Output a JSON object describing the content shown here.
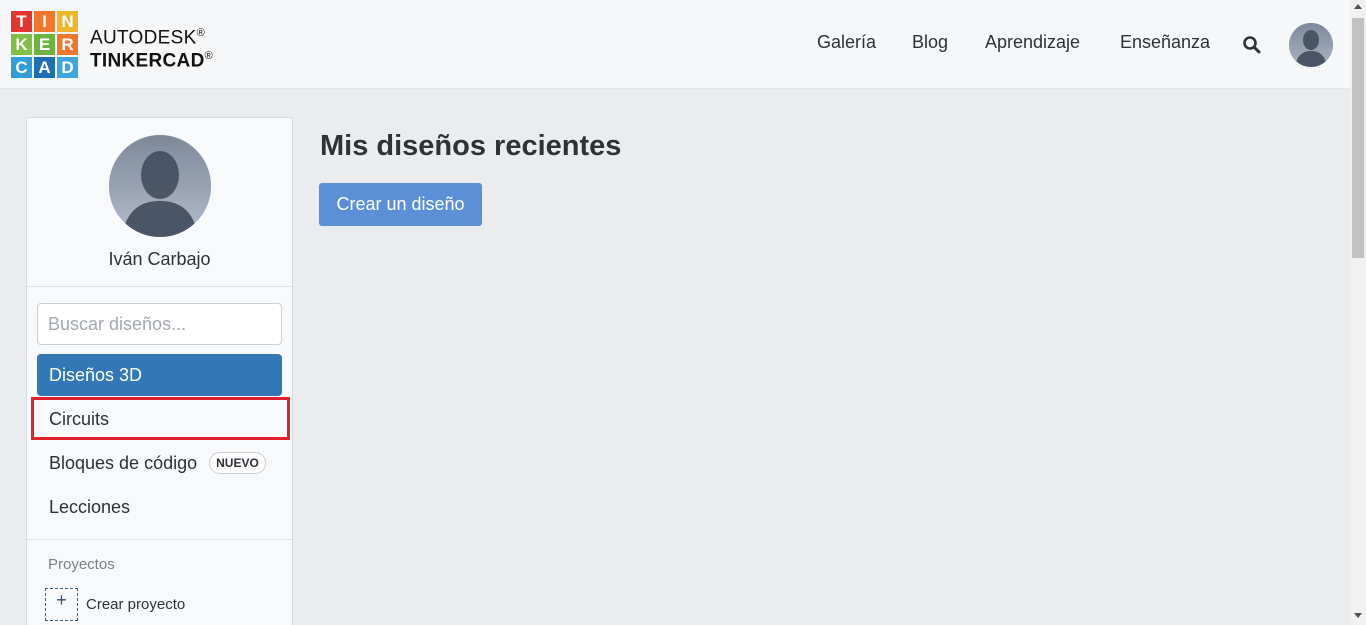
{
  "header": {
    "logo_letters": [
      "T",
      "I",
      "N",
      "K",
      "E",
      "R",
      "C",
      "A",
      "D"
    ],
    "logo_colors": [
      "#e3342f",
      "#f0772d",
      "#eeb629",
      "#81c046",
      "#6db33f",
      "#f0772d",
      "#2f9ed8",
      "#1f6fb3",
      "#3ea6df"
    ],
    "brand_line1": "AUTODESK",
    "brand_line2": "TINKERCAD",
    "trademark": "®",
    "nav": {
      "gallery": "Galería",
      "blog": "Blog",
      "learning": "Aprendizaje",
      "teaching": "Enseñanza"
    },
    "search_icon": "search-icon",
    "avatar_icon": "user-avatar-icon"
  },
  "sidebar": {
    "user_name": "Iván Carbajo",
    "search_placeholder": "Buscar diseños...",
    "menu": {
      "designs_3d": "Diseños 3D",
      "circuits": "Circuits",
      "codeblocks": "Bloques de código",
      "codeblocks_badge": "NUEVO",
      "lessons": "Lecciones"
    },
    "projects_label": "Proyectos",
    "create_project": "Crear proyecto"
  },
  "main": {
    "title": "Mis diseños recientes",
    "create_button": "Crear un diseño"
  },
  "colors": {
    "active_item": "#3277b6",
    "create_button": "#5b8fd6",
    "highlight": "#e0202d"
  }
}
